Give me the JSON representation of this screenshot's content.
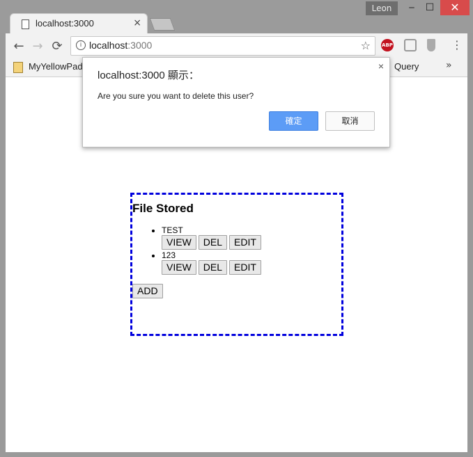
{
  "window": {
    "user": "Leon",
    "min": "‒",
    "max": "☐",
    "close": "✕"
  },
  "tab": {
    "title": "localhost:3000",
    "close": "×"
  },
  "toolbar": {
    "back": "←",
    "forward": "→",
    "reload": "⟳",
    "url_host": "localhost",
    "url_port": ":3000",
    "star": "☆",
    "abp": "ABP",
    "menu": "⋮"
  },
  "bookmarks": {
    "item1": "MyYellowPad",
    "item2": "Query",
    "more": "»"
  },
  "page": {
    "heading": "File Stored",
    "files": [
      {
        "name": "TEST",
        "view": "VIEW",
        "del": "DEL",
        "edit": "EDIT"
      },
      {
        "name": "123",
        "view": "VIEW",
        "del": "DEL",
        "edit": "EDIT"
      }
    ],
    "add": "ADD",
    "border_color": "#0000dd"
  },
  "dialog": {
    "title": "localhost:3000 顯示：",
    "message": "Are you sure you want to delete this user?",
    "ok": "確定",
    "cancel": "取消",
    "close": "×"
  }
}
